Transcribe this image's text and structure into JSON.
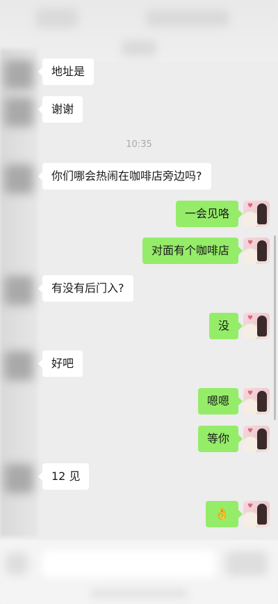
{
  "timestamp": "10:35",
  "messages": [
    {
      "side": "in",
      "text": "地址是"
    },
    {
      "side": "in",
      "text": "谢谢"
    },
    {
      "side": "in",
      "text": "你们哪会热闹在咖啡店旁边吗?"
    },
    {
      "side": "out",
      "text": "一会见咯"
    },
    {
      "side": "out",
      "text": "对面有个咖啡店"
    },
    {
      "side": "in",
      "text": "有没有后门入?"
    },
    {
      "side": "out",
      "text": "没"
    },
    {
      "side": "in",
      "text": "好吧"
    },
    {
      "side": "out",
      "text": "嗯嗯"
    },
    {
      "side": "out",
      "text": "等你"
    },
    {
      "side": "in",
      "text": "12 见"
    },
    {
      "side": "out",
      "icon": "ok-hand-emoji",
      "glyph": "👌"
    }
  ],
  "colors": {
    "background": "#ededed",
    "incoming_bubble": "#ffffff",
    "outgoing_bubble": "#95ec69",
    "timestamp_text": "#a9a9a9"
  }
}
